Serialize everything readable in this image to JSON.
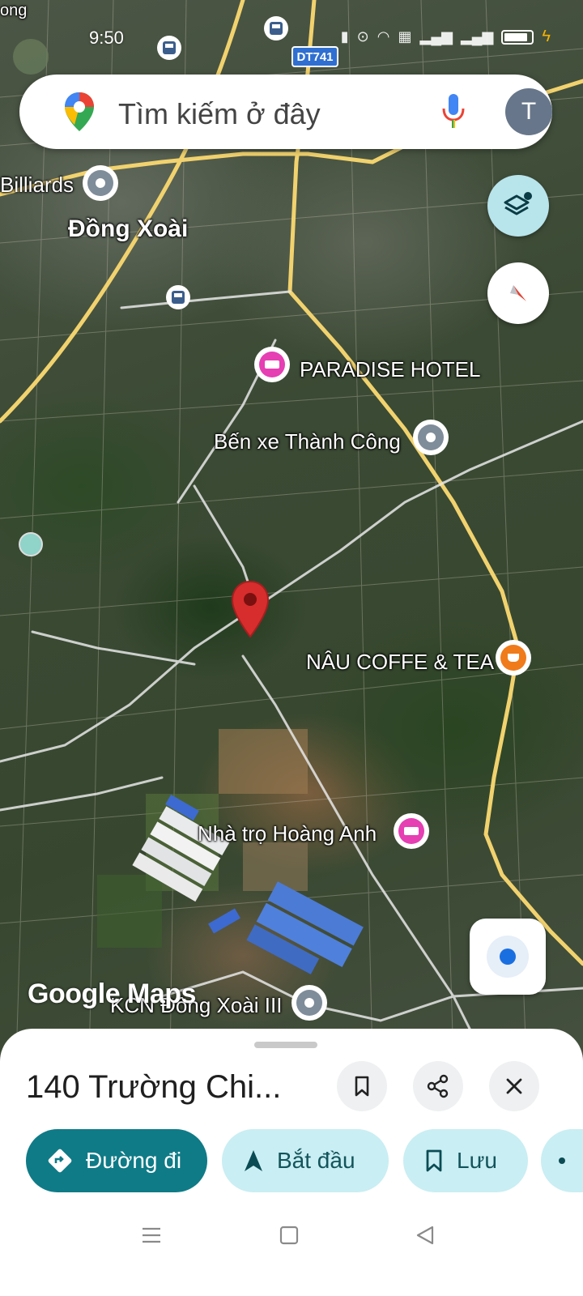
{
  "status_bar": {
    "time": "9:50"
  },
  "search": {
    "placeholder": "Tìm kiếm ở đây",
    "avatar_letter": "T"
  },
  "map": {
    "road_shield": "DT741",
    "corner_label": "ong",
    "labels": {
      "billiards": "Billiards",
      "city": "Đồng Xoài",
      "paradise": "PARADISE HOTEL",
      "ben_xe": "Bến xe Thành Công",
      "nau_coffee": "NÂU COFFE & TEA",
      "nha_tro": "Nhà trọ Hoàng Anh",
      "kcn": "KCN Đồng Xoài III"
    },
    "watermark": "Google Maps"
  },
  "sheet": {
    "title": "140 Trường Chi...",
    "actions": {
      "directions": "Đường đi",
      "start": "Bắt đầu",
      "save": "Lưu"
    }
  },
  "colors": {
    "primary_chip": "#0f7b87",
    "light_chip": "#c9eef3",
    "pin": "#d72d2d"
  }
}
